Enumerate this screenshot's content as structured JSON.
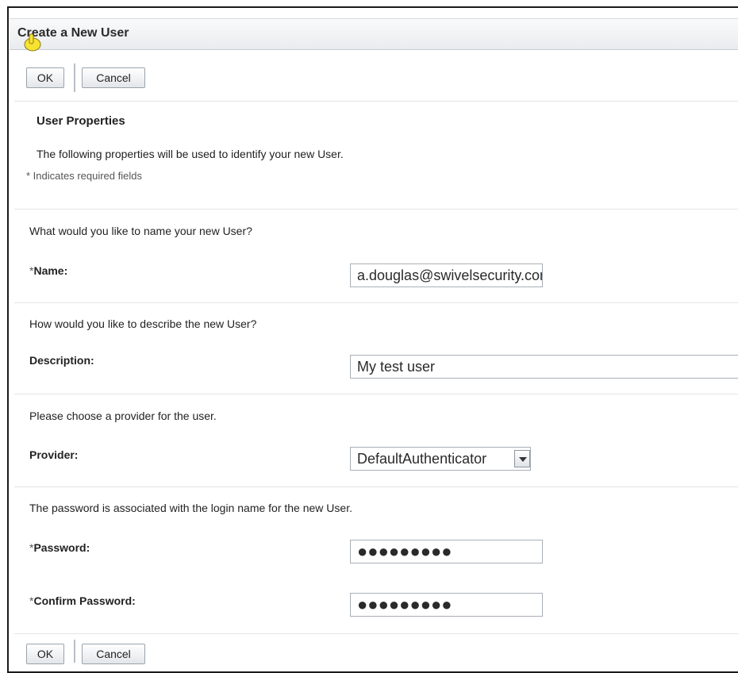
{
  "dialog": {
    "title": "Create a New User"
  },
  "top_buttons": {
    "ok": "OK",
    "cancel": "Cancel"
  },
  "bottom_buttons": {
    "ok": "OK",
    "cancel": "Cancel"
  },
  "section": {
    "heading": "User Properties",
    "intro": "The following properties will be used to identify your new User.",
    "required_note": "* Indicates required fields"
  },
  "name_block": {
    "question": "What would you like to name your new User?",
    "label": "Name:",
    "required_mark": "*",
    "value": "a.douglas@swivelsecurity.com"
  },
  "description_block": {
    "question": "How would you like to describe the new User?",
    "label": "Description:",
    "value": "My test user"
  },
  "provider_block": {
    "question": "Please choose a provider for the user.",
    "label": "Provider:",
    "selected": "DefaultAuthenticator"
  },
  "password_block": {
    "note": "The password is associated with the login name for the new User.",
    "password_label": "Password:",
    "password_required_mark": "*",
    "password_value": "●●●●●●●●●",
    "confirm_label": "Confirm Password:",
    "confirm_required_mark": "*",
    "confirm_value": "●●●●●●●●●"
  },
  "cursor": {
    "icon": "hand-pointer-icon"
  }
}
